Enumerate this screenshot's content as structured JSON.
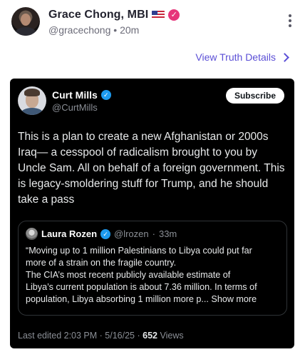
{
  "post": {
    "author_name": "Grace Chong, MBI",
    "handle": "@gracechong",
    "separator": "•",
    "time_ago": "20m",
    "details_link": "View Truth Details",
    "flag_icon": "us-flag-icon",
    "badge_color": "#e6357a"
  },
  "embed": {
    "author_name": "Curt Mills",
    "handle": "@CurtMills",
    "subscribe_label": "Subscribe",
    "text_lines": [
      "This is a plan to create a new Afghanistan or 2000s",
      "Iraq— a cesspool of radicalism brought to you by Uncle",
      "Sam. All on behalf of a foreign government. This is",
      "legacy-smoldering stuff for Trump, and he should take",
      "a pass"
    ],
    "badge_color": "#1d9bf0",
    "quote": {
      "author_name": "Laura Rozen",
      "handle": "@lrozen",
      "separator": "·",
      "time_ago": "33m",
      "text_lines": [
        "“Moving up to 1 million Palestinians to Libya could put far",
        "more of a strain on the fragile country.",
        "The CIA’s most recent publicly available estimate of",
        "Libya’s current population is about 7.36 million. In terms of",
        "population, Libya absorbing 1 million more p... Show more"
      ]
    },
    "footer": {
      "edited_label": "Last edited 2:03 PM · 5/16/25",
      "dot": "·",
      "views_count": "652",
      "views_label": "Views"
    }
  }
}
